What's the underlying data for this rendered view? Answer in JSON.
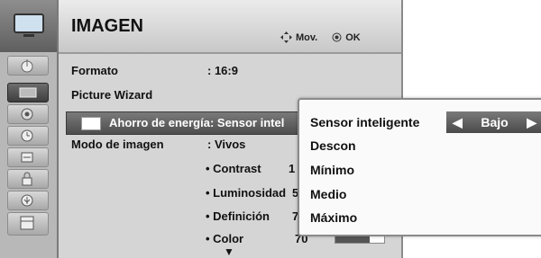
{
  "menu": {
    "title": "IMAGEN",
    "nav_move_label": "Mov.",
    "nav_ok_label": "OK",
    "icons": [
      "antenna-icon",
      "picture-icon",
      "speaker-icon",
      "clock-icon",
      "options-icon",
      "lock-icon",
      "usb-icon",
      "film-icon"
    ],
    "selected_icon": "picture-icon"
  },
  "rows": {
    "formato_label": "Formato",
    "formato_value": ": 16:9",
    "wizard_label": "Picture Wizard",
    "energy_label": "Ahorro de energía: Sensor intel",
    "modo_label": "Modo de imagen",
    "modo_value": ": Vivos",
    "contrast_label": "• Contrast",
    "contrast_value": "1",
    "luminosidad_label": "• Luminosidad",
    "luminosidad_value": "5",
    "definicion_label": "• Definición",
    "definicion_value": "7",
    "color_label": "• Color",
    "color_value": "70",
    "color_level": 0.7
  },
  "popup": {
    "current_label": "Sensor inteligente",
    "current_value": "Bajo",
    "options": [
      "Descon",
      "Mínimo",
      "Medio",
      "Máximo"
    ]
  },
  "colors": {
    "panel": "#d5d5d5",
    "highlight": "#5a5a5a",
    "popup": "#fafafa"
  }
}
